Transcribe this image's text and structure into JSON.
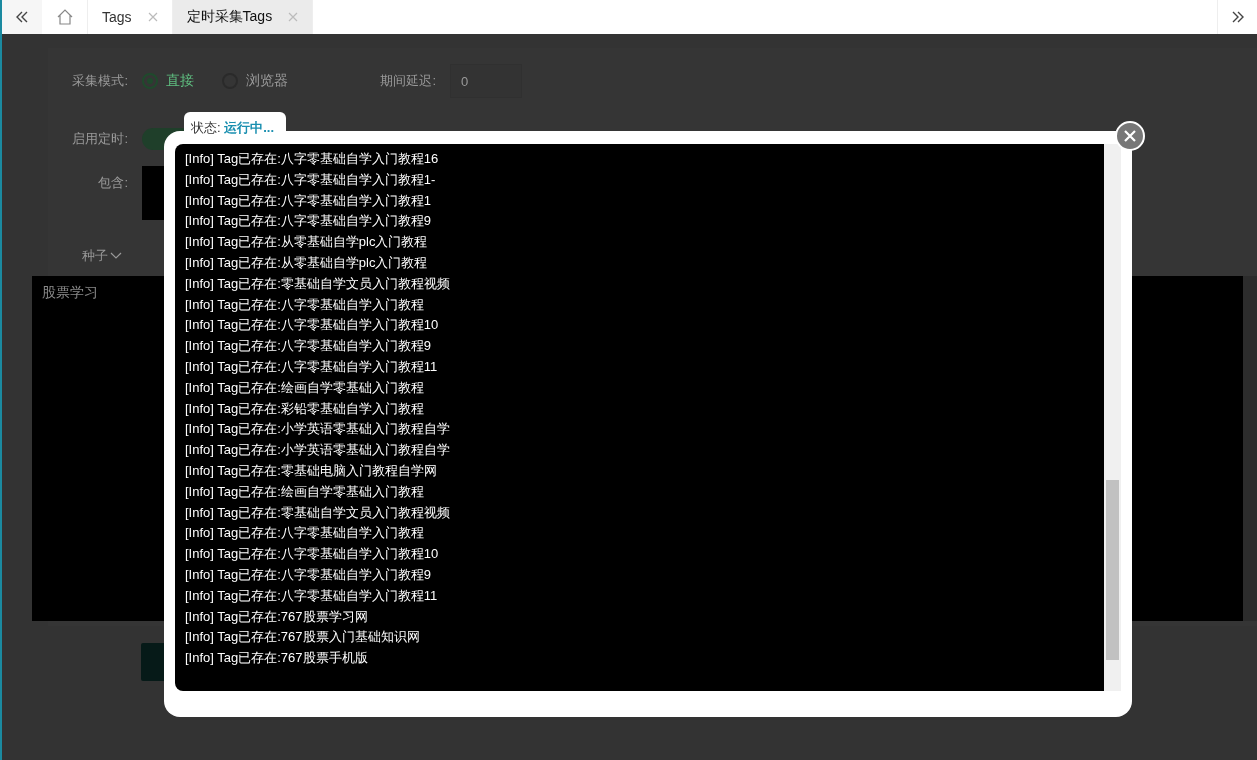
{
  "tabs": [
    {
      "kind": "home",
      "selected": false
    },
    {
      "kind": "page",
      "label": "Tags",
      "selected": false
    },
    {
      "kind": "page",
      "label": "定时采集Tags",
      "selected": true
    }
  ],
  "form": {
    "mode_label": "采集模式:",
    "mode_options": [
      {
        "label": "直接",
        "selected": true
      },
      {
        "label": "浏览器",
        "selected": false
      }
    ],
    "delay_label": "期间延迟:",
    "delay_value": "0",
    "schedule_label": "启用定时:",
    "schedule_on": true,
    "include_label": "包含:",
    "seed_label": "种子",
    "seed_text": "股票学习"
  },
  "dialog": {
    "status_label": "状态:",
    "status_value": "运行中...",
    "log": [
      "[Info] Tag已存在:八字零基础自学入门教程16",
      "[Info] Tag已存在:八字零基础自学入门教程1-",
      "[Info] Tag已存在:八字零基础自学入门教程1",
      "[Info] Tag已存在:八字零基础自学入门教程9",
      "[Info] Tag已存在:从零基础自学plc入门教程",
      "[Info] Tag已存在:从零基础自学plc入门教程",
      "[Info] Tag已存在:零基础自学文员入门教程视频",
      "[Info] Tag已存在:八字零基础自学入门教程",
      "[Info] Tag已存在:八字零基础自学入门教程10",
      "[Info] Tag已存在:八字零基础自学入门教程9",
      "[Info] Tag已存在:八字零基础自学入门教程11",
      "[Info] Tag已存在:绘画自学零基础入门教程",
      "[Info] Tag已存在:彩铅零基础自学入门教程",
      "[Info] Tag已存在:小学英语零基础入门教程自学",
      "[Info] Tag已存在:小学英语零基础入门教程自学",
      "[Info] Tag已存在:零基础电脑入门教程自学网",
      "[Info] Tag已存在:绘画自学零基础入门教程",
      "[Info] Tag已存在:零基础自学文员入门教程视频",
      "[Info] Tag已存在:八字零基础自学入门教程",
      "[Info] Tag已存在:八字零基础自学入门教程10",
      "[Info] Tag已存在:八字零基础自学入门教程9",
      "[Info] Tag已存在:八字零基础自学入门教程11",
      "[Info] Tag已存在:767股票学习网",
      "[Info] Tag已存在:767股票入门基础知识网",
      "[Info] Tag已存在:767股票手机版"
    ]
  }
}
